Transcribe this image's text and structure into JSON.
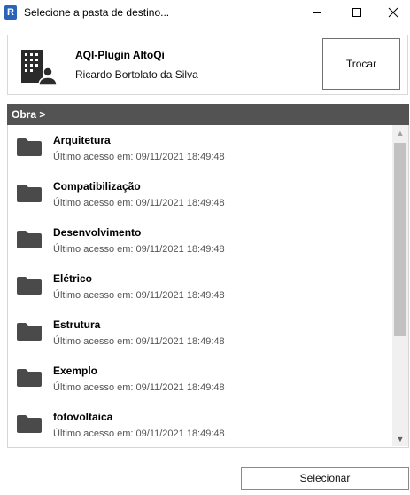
{
  "window": {
    "title": "Selecione a pasta de destino...",
    "app_icon_letter": "R",
    "controls": [
      "minimize-icon",
      "maximize-icon",
      "close-icon"
    ]
  },
  "account": {
    "plugin_name": "AQI-Plugin AltoQi",
    "user_name": "Ricardo Bortolato da Silva",
    "switch_label": "Trocar",
    "icon": "building-user-icon"
  },
  "breadcrumb": {
    "label": "Obra >"
  },
  "folders": [
    {
      "name": "Arquitetura",
      "last_access": "Último acesso em:  09/11/2021 18:49:48"
    },
    {
      "name": "Compatibilização",
      "last_access": "Último acesso em:  09/11/2021 18:49:48"
    },
    {
      "name": "Desenvolvimento",
      "last_access": "Último acesso em:  09/11/2021 18:49:48"
    },
    {
      "name": "Elétrico",
      "last_access": "Último acesso em:  09/11/2021 18:49:48"
    },
    {
      "name": "Estrutura",
      "last_access": "Último acesso em:  09/11/2021 18:49:48"
    },
    {
      "name": "Exemplo",
      "last_access": "Último acesso em:  09/11/2021 18:49:48"
    },
    {
      "name": "fotovoltaica",
      "last_access": "Último acesso em:  09/11/2021 18:49:48"
    }
  ],
  "footer": {
    "select_label": "Selecionar"
  },
  "colors": {
    "header_bar": "#535353",
    "folder_icon": "#4a4a4a",
    "app_icon": "#2a64b8"
  }
}
